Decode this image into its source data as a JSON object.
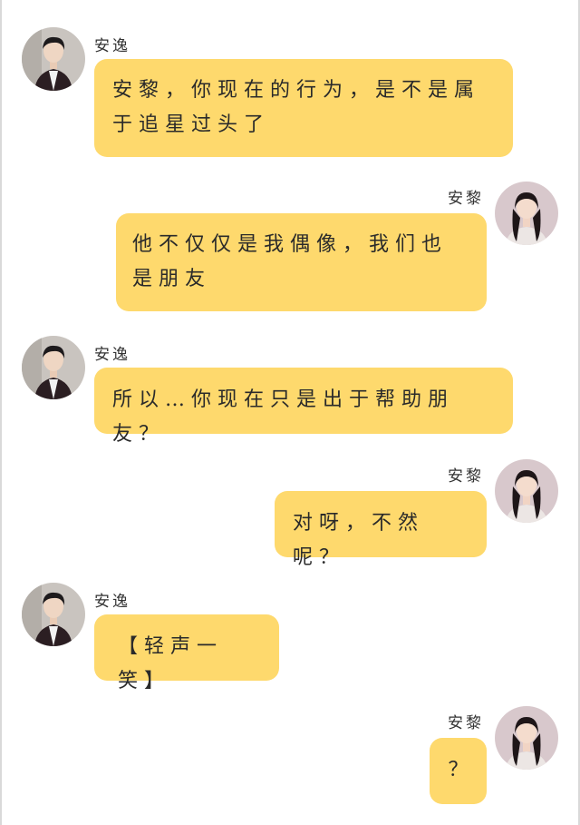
{
  "conversation": {
    "messages": [
      {
        "side": "left",
        "sender": "安逸",
        "text": "安黎，你现在的行为，是不是属于追星过头了"
      },
      {
        "side": "right",
        "sender": "安黎",
        "text": "他不仅仅是我偶像，我们也是朋友"
      },
      {
        "side": "left",
        "sender": "安逸",
        "text": "所以…你现在只是出于帮助朋友？"
      },
      {
        "side": "right",
        "sender": "安黎",
        "text": "对呀，不然呢？"
      },
      {
        "side": "left",
        "sender": "安逸",
        "text": "【轻声一笑】"
      },
      {
        "side": "right",
        "sender": "安黎",
        "text": "？"
      }
    ]
  },
  "colors": {
    "bubble": "#fed96d",
    "background": "#ffffff"
  },
  "icons": {
    "male_avatar": "male-avatar-icon",
    "female_avatar": "female-avatar-icon"
  }
}
